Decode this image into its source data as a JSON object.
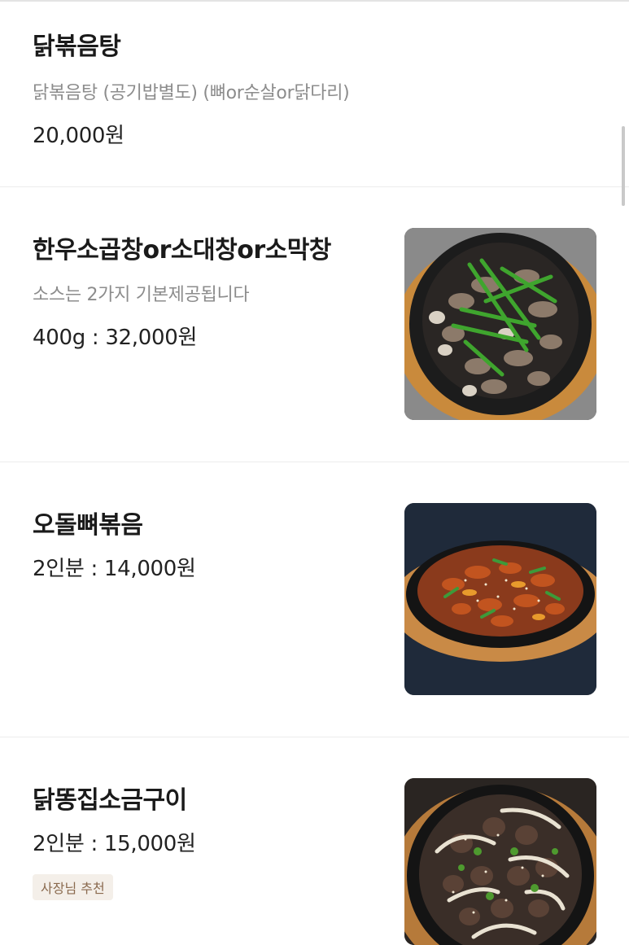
{
  "menu": {
    "items": [
      {
        "name": "닭볶음탕",
        "description": "닭볶음탕 (공기밥별도) (뼈or순살or닭다리)",
        "price": "20,000원"
      },
      {
        "name": "한우소곱창or소대창or소막창",
        "description": "소스는 2가지 기본제공됩니다",
        "price": "400g : 32,000원",
        "image": "grilled-beef-intestine-photo"
      },
      {
        "name": "오돌뼈볶음",
        "price": "2인분 : 14,000원",
        "image": "spicy-pork-cartilage-stirfry-photo"
      },
      {
        "name": "닭똥집소금구이",
        "price": "2인분 : 15,000원",
        "badge": "사장님 추천",
        "image": "salt-grilled-chicken-gizzard-photo"
      }
    ]
  },
  "colors": {
    "title": "#1a1a1a",
    "description": "#8c8c8c",
    "badge_bg": "#f4efe9",
    "badge_text": "#8a6a4e",
    "divider": "#ececec"
  }
}
